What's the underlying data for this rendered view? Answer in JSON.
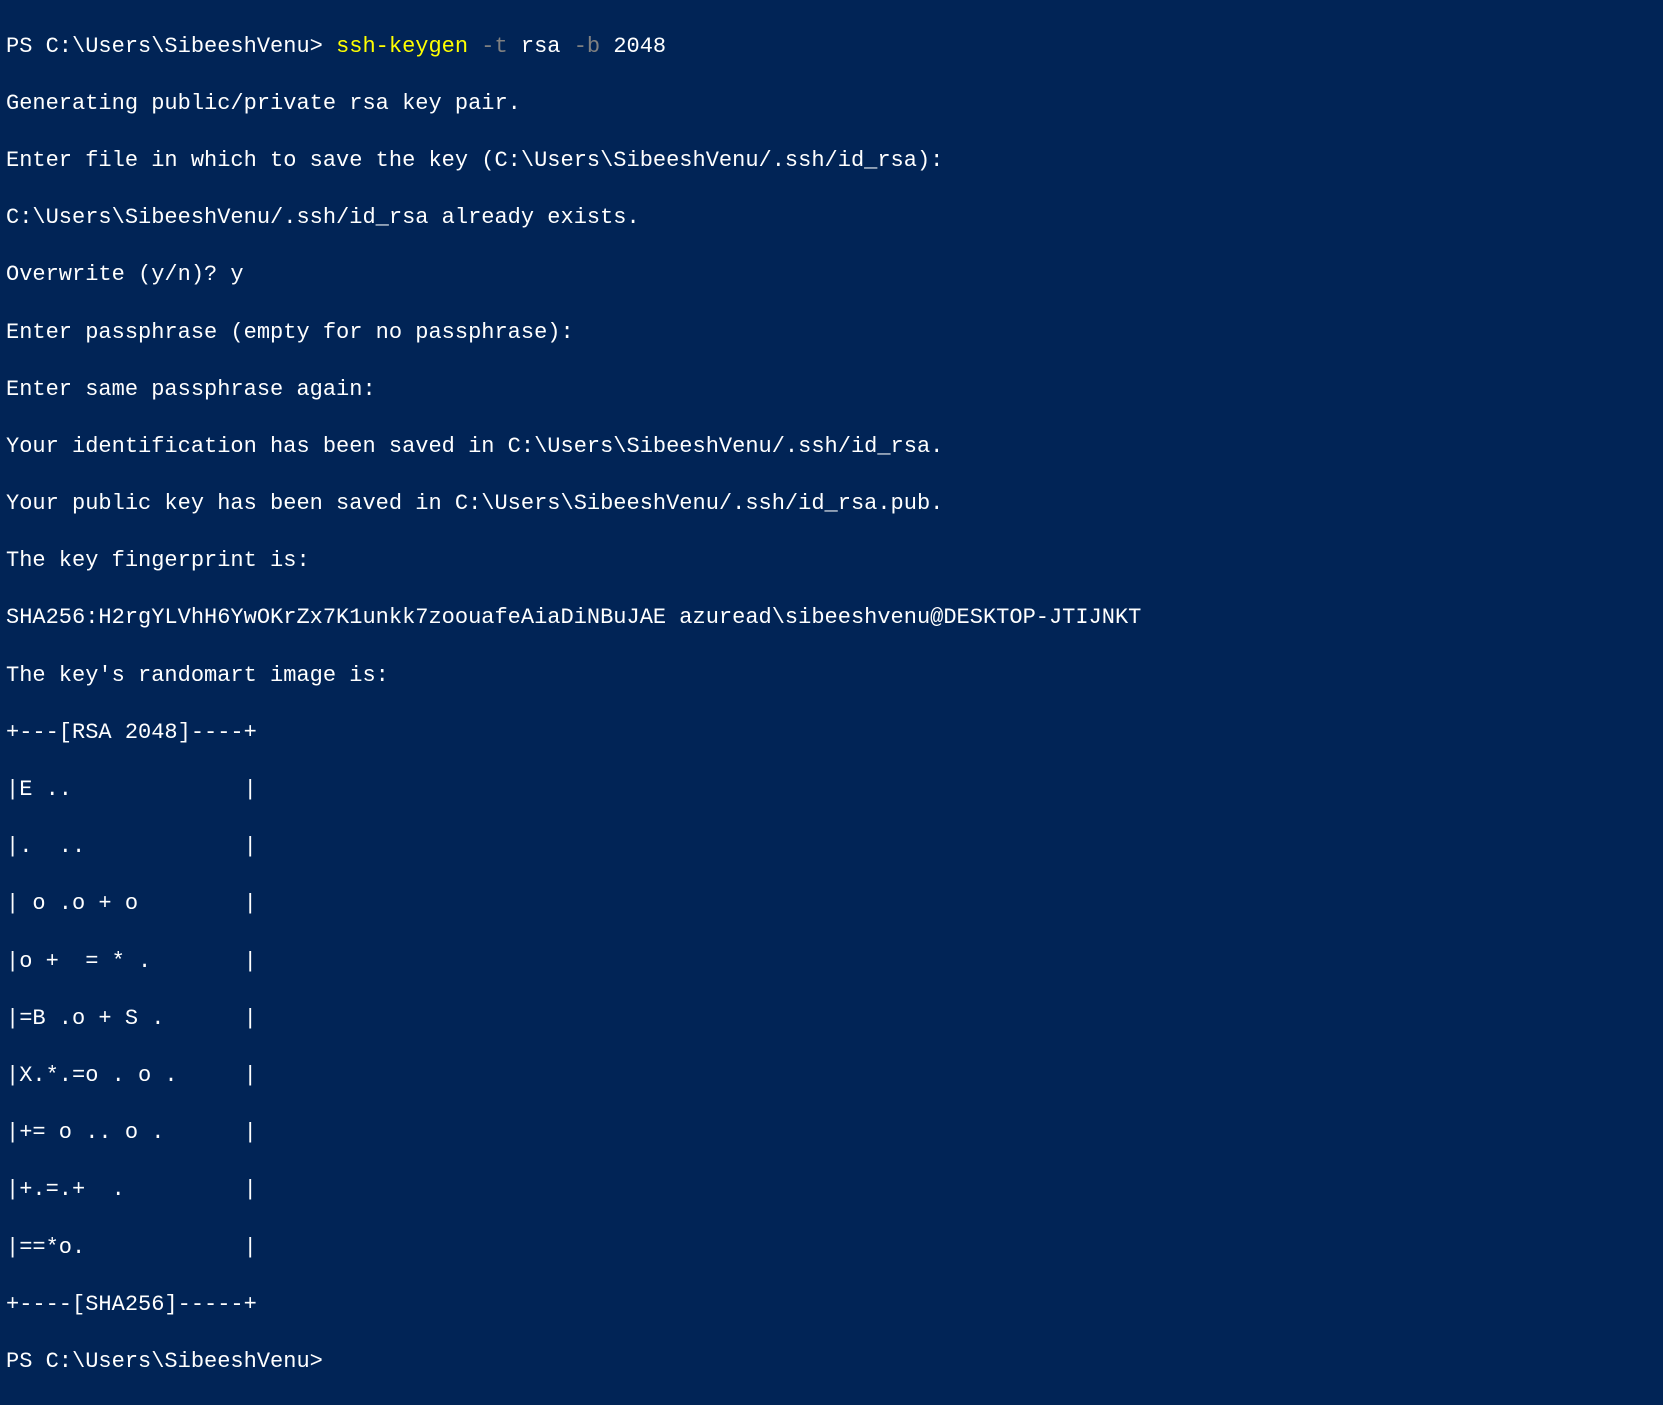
{
  "terminal": {
    "prompt1": "PS C:\\Users\\SibeeshVenu> ",
    "command_name": "ssh-keygen ",
    "flag_t": "-t ",
    "arg_rsa": "rsa ",
    "flag_b": "-b ",
    "arg_2048": "2048",
    "output_lines": [
      "Generating public/private rsa key pair.",
      "Enter file in which to save the key (C:\\Users\\SibeeshVenu/.ssh/id_rsa):",
      "C:\\Users\\SibeeshVenu/.ssh/id_rsa already exists.",
      "Overwrite (y/n)? y",
      "Enter passphrase (empty for no passphrase):",
      "Enter same passphrase again:",
      "Your identification has been saved in C:\\Users\\SibeeshVenu/.ssh/id_rsa.",
      "Your public key has been saved in C:\\Users\\SibeeshVenu/.ssh/id_rsa.pub.",
      "The key fingerprint is:",
      "SHA256:H2rgYLVhH6YwOKrZx7K1unkk7zoouafeAiaDiNBuJAE azuread\\sibeeshvenu@DESKTOP-JTIJNKT",
      "The key's randomart image is:",
      "+---[RSA 2048]----+",
      "|E ..             |",
      "|.  ..            |",
      "| o .o + o        |",
      "|o +  = * .       |",
      "|=B .o + S .      |",
      "|X.*.=o . o .     |",
      "|+= o .. o .      |",
      "|+.=.+  .         |",
      "|==*o.            |",
      "+----[SHA256]-----+"
    ],
    "prompt2": "PS C:\\Users\\SibeeshVenu>"
  }
}
